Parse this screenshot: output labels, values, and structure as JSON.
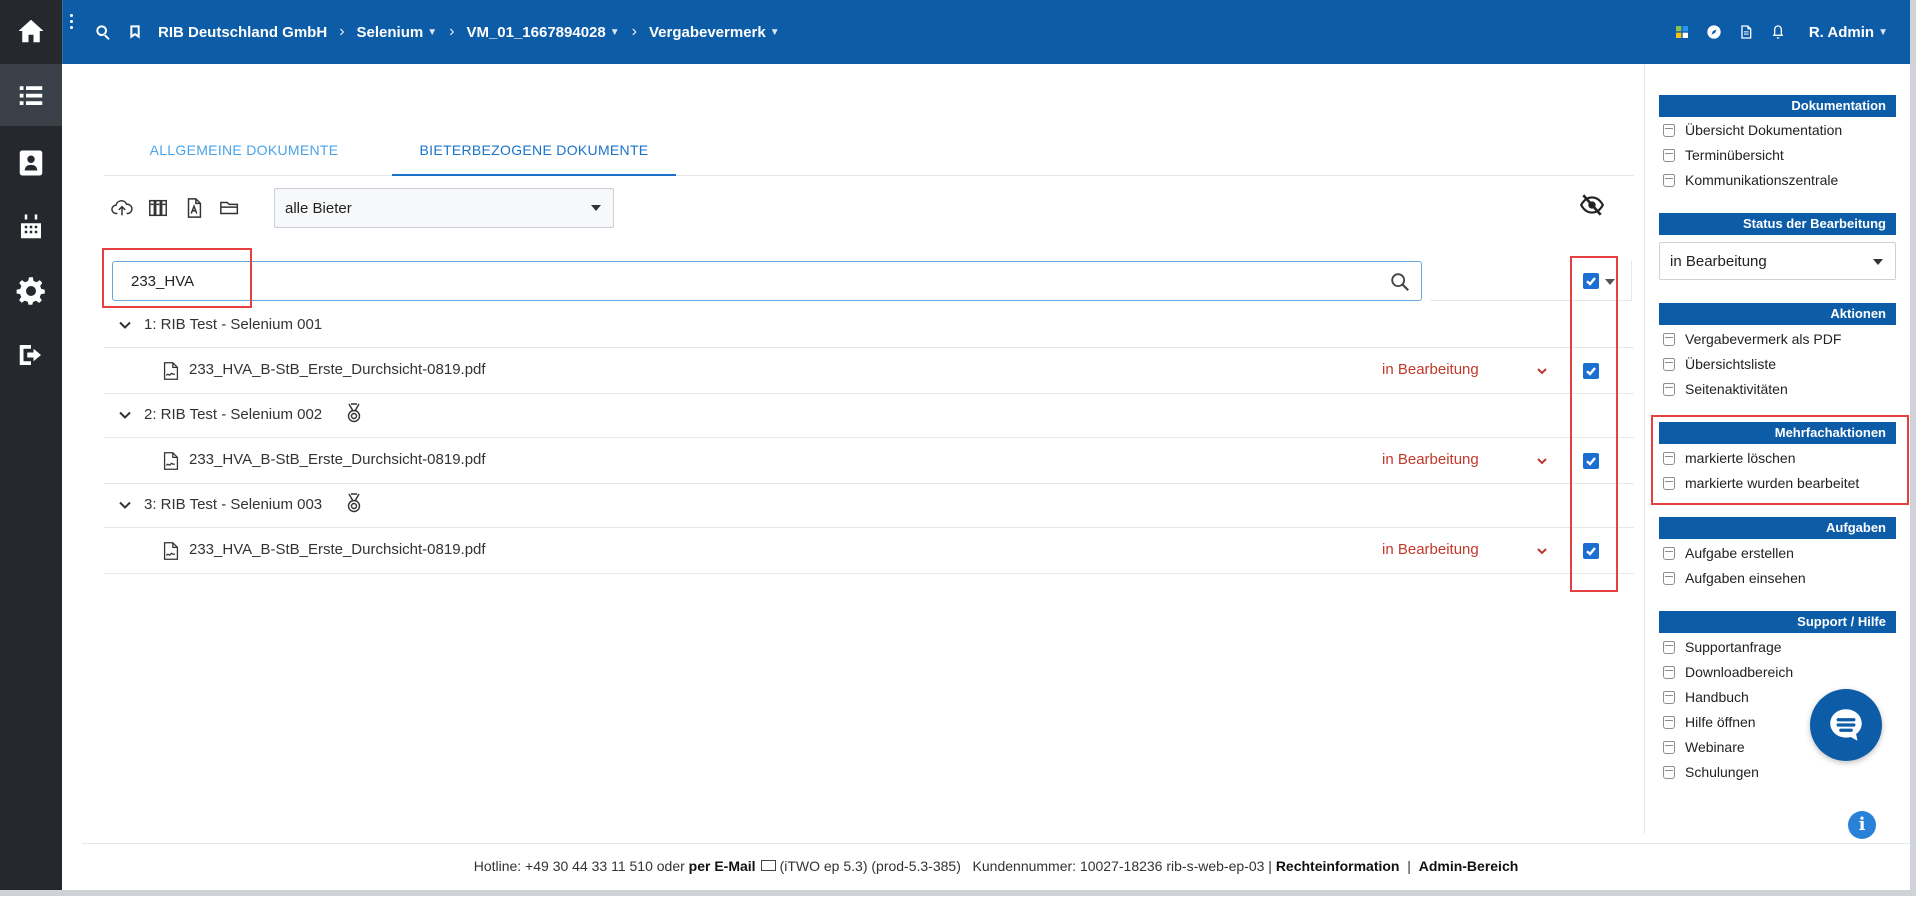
{
  "header": {
    "breadcrumb": [
      {
        "label": "RIB Deutschland GmbH",
        "dropdown": false
      },
      {
        "label": "Selenium",
        "dropdown": true
      },
      {
        "label": "VM_01_1667894028",
        "dropdown": true
      },
      {
        "label": "Vergabevermerk",
        "dropdown": true
      }
    ],
    "user": "R. Admin",
    "accent": "#0d5ca8"
  },
  "sidebar": {
    "items": [
      {
        "icon": "home-icon"
      },
      {
        "icon": "list-icon"
      },
      {
        "icon": "contacts-icon"
      },
      {
        "icon": "calendar-icon"
      },
      {
        "icon": "gear-icon"
      },
      {
        "icon": "logout-icon"
      }
    ]
  },
  "tabs": [
    {
      "label": "ALLGEMEINE DOKUMENTE"
    },
    {
      "label": "BIETERBEZOGENE DOKUMENTE"
    }
  ],
  "toolbar": {
    "bieter_select": "alle Bieter"
  },
  "search": {
    "value": "233_HVA"
  },
  "groups": [
    {
      "label": "1: RIB Test - Selenium 001",
      "medal": false,
      "file": {
        "name": "233_HVA_B-StB_Erste_Durchsicht-0819.pdf",
        "status": "in Bearbeitung"
      }
    },
    {
      "label": "2: RIB Test - Selenium 002",
      "medal": true,
      "file": {
        "name": "233_HVA_B-StB_Erste_Durchsicht-0819.pdf",
        "status": "in Bearbeitung"
      }
    },
    {
      "label": "3: RIB Test - Selenium 003",
      "medal": true,
      "file": {
        "name": "233_HVA_B-StB_Erste_Durchsicht-0819.pdf",
        "status": "in Bearbeitung"
      }
    }
  ],
  "right_panel": {
    "dokumentation": {
      "title": "Dokumentation",
      "items": [
        "Übersicht Dokumentation",
        "Terminübersicht",
        "Kommunikationszentrale"
      ]
    },
    "status": {
      "title": "Status der Bearbeitung",
      "value": "in Bearbeitung"
    },
    "aktionen": {
      "title": "Aktionen",
      "items": [
        "Vergabevermerk als PDF",
        "Übersichtsliste",
        "Seitenaktivitäten"
      ]
    },
    "mehrfach": {
      "title": "Mehrfachaktionen",
      "items": [
        "markierte löschen",
        "markierte wurden bearbeitet"
      ]
    },
    "aufgaben": {
      "title": "Aufgaben",
      "items": [
        "Aufgabe erstellen",
        "Aufgaben einsehen"
      ]
    },
    "support": {
      "title": "Support / Hilfe",
      "items": [
        "Supportanfrage",
        "Downloadbereich",
        "Handbuch",
        "Hilfe öffnen",
        "Webinare",
        "Schulungen"
      ]
    }
  },
  "footer": {
    "hotline": "Hotline: +49 30 44 33 11 510 oder",
    "email_label": "per E-Mail",
    "version": "(iTWO ep 5.3) (prod-5.3-385)",
    "kunde": "Kundennummer: 10027-18236 rib-s-web-ep-03 |",
    "recht": "Rechteinformation",
    "sep": "|",
    "admin": "Admin-Bereich"
  },
  "colors": {
    "status_red": "#c0392b",
    "highlight_red": "#e64040",
    "tab_active": "#1a73c9"
  }
}
